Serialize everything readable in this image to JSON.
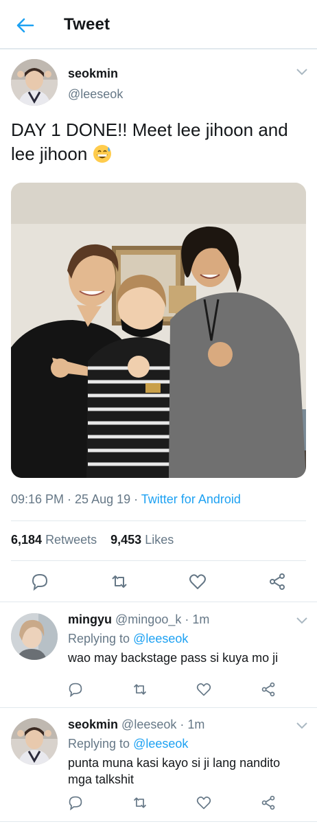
{
  "header": {
    "title": "Tweet",
    "back_icon": "arrow-left-icon",
    "accent": "#1da1f2"
  },
  "tweet": {
    "author_name": "seokmin",
    "author_handle": "@leeseok",
    "text": "DAY 1 DONE!! Meet lee jihoon and lee jihoon",
    "emoji": "grinning-sweat-emoji",
    "time": "09:16 PM · 25 Aug 19 · ",
    "source": "Twitter for Android",
    "retweets_count": "6,184",
    "retweets_label": "Retweets",
    "likes_count": "9,453",
    "likes_label": "Likes"
  },
  "replies": [
    {
      "name": "mingyu",
      "handle": "@mingoo_k · 1m",
      "replying_label": "Replying to ",
      "replying_to": "@leeseok",
      "text": "wao may backstage pass si kuya mo ji"
    },
    {
      "name": "seokmin",
      "handle": "@leeseok · 1m",
      "replying_label": "Replying to ",
      "replying_to": "@leeseok",
      "text": "punta muna kasi kayo si ji lang nandito mga talkshit"
    }
  ],
  "colors": {
    "text": "#14171a",
    "secondary": "#657786",
    "link": "#1da1f2",
    "divider": "#e1e8ed"
  }
}
